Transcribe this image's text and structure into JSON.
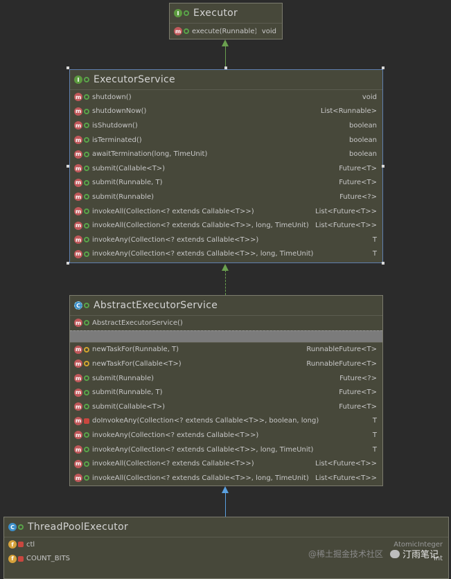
{
  "executor": {
    "title": "Executor",
    "methods": [
      {
        "name": "execute(Runnable)",
        "type": "void"
      }
    ]
  },
  "executor_service": {
    "title": "ExecutorService",
    "methods": [
      {
        "name": "shutdown()",
        "type": "void"
      },
      {
        "name": "shutdownNow()",
        "type": "List<Runnable>"
      },
      {
        "name": "isShutdown()",
        "type": "boolean"
      },
      {
        "name": "isTerminated()",
        "type": "boolean"
      },
      {
        "name": "awaitTermination(long, TimeUnit)",
        "type": "boolean"
      },
      {
        "name": "submit(Callable<T>)",
        "type": "Future<T>"
      },
      {
        "name": "submit(Runnable, T)",
        "type": "Future<T>"
      },
      {
        "name": "submit(Runnable)",
        "type": "Future<?>"
      },
      {
        "name": "invokeAll(Collection<? extends Callable<T>>)",
        "type": "List<Future<T>>"
      },
      {
        "name": "invokeAll(Collection<? extends Callable<T>>, long, TimeUnit)",
        "type": "List<Future<T>>"
      },
      {
        "name": "invokeAny(Collection<? extends Callable<T>>)",
        "type": "T"
      },
      {
        "name": "invokeAny(Collection<? extends Callable<T>>, long, TimeUnit)",
        "type": "T"
      }
    ]
  },
  "abstract_executor_service": {
    "title": "AbstractExecutorService",
    "constructor": "AbstractExecutorService()",
    "methods": [
      {
        "name": "newTaskFor(Runnable, T)",
        "type": "RunnableFuture<T>",
        "vis": "prot"
      },
      {
        "name": "newTaskFor(Callable<T>)",
        "type": "RunnableFuture<T>",
        "vis": "prot"
      },
      {
        "name": "submit(Runnable)",
        "type": "Future<?>",
        "vis": "pub"
      },
      {
        "name": "submit(Runnable, T)",
        "type": "Future<T>",
        "vis": "pub"
      },
      {
        "name": "submit(Callable<T>)",
        "type": "Future<T>",
        "vis": "pub"
      },
      {
        "name": "doInvokeAny(Collection<? extends Callable<T>>, boolean, long)",
        "type": "T",
        "vis": "priv"
      },
      {
        "name": "invokeAny(Collection<? extends Callable<T>>)",
        "type": "T",
        "vis": "pub"
      },
      {
        "name": "invokeAny(Collection<? extends Callable<T>>, long, TimeUnit)",
        "type": "T",
        "vis": "pub"
      },
      {
        "name": "invokeAll(Collection<? extends Callable<T>>)",
        "type": "List<Future<T>>",
        "vis": "pub"
      },
      {
        "name": "invokeAll(Collection<? extends Callable<T>>, long, TimeUnit)",
        "type": "List<Future<T>>",
        "vis": "pub"
      }
    ]
  },
  "thread_pool_executor": {
    "title": "ThreadPoolExecutor",
    "fields": [
      {
        "name": "ctl",
        "type": "AtomicInteger"
      },
      {
        "name": "COUNT_BITS",
        "type": "int"
      }
    ]
  },
  "watermark": {
    "faint": "@稀土掘金技术社区",
    "text": "汀雨笔记"
  },
  "colors": {
    "background": "#2b2b2b",
    "box": "#47483a",
    "method_icon": "#c0585a",
    "interface_icon": "#5c9a3f",
    "class_icon": "#3d8fc9",
    "field_icon": "#d6a23c",
    "inherit_arrow": "#6aa04f",
    "extends_arrow": "#5aa0e0"
  }
}
